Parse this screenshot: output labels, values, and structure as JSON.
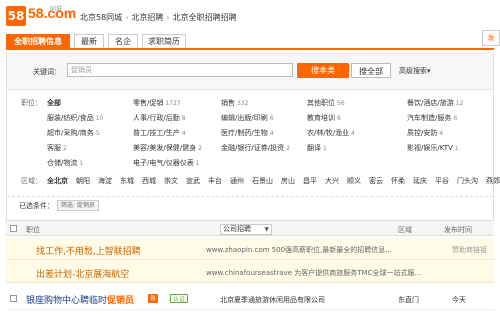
{
  "header": {
    "logo_text": "58.com",
    "logo_sub": "同城",
    "breadcrumb": [
      "北京58同城",
      "北京招聘",
      "北京全职招聘招聘"
    ]
  },
  "tabs": [
    "全职招聘信息",
    "最新",
    "名企",
    "求职简历"
  ],
  "tab_cut_label": "发",
  "search": {
    "label": "关键词：",
    "value": "促销员",
    "search_button": "搜本类",
    "search_all_button": "搜全部",
    "advanced": "高级搜索▾"
  },
  "job_categories": {
    "label": "职位：",
    "items": [
      {
        "text": "全部",
        "num": ""
      },
      {
        "text": "零售/促销",
        "num": "1727"
      },
      {
        "text": "销售",
        "num": "332"
      },
      {
        "text": "其他职位",
        "num": "56"
      },
      {
        "text": "餐饮/酒店/旅游",
        "num": "12"
      },
      {
        "text": "服装/纺织/食品",
        "num": "10"
      },
      {
        "text": "人事/行政/后勤",
        "num": "8"
      },
      {
        "text": "编辑/出版/印刷",
        "num": "6"
      },
      {
        "text": "教育培训",
        "num": "6"
      },
      {
        "text": "汽车制造/服务",
        "num": "6"
      },
      {
        "text": "超市/采购/商务",
        "num": "5"
      },
      {
        "text": "普工/技工/生产",
        "num": "4"
      },
      {
        "text": "医疗/制药/生物",
        "num": "4"
      },
      {
        "text": "农/林/牧/渔业",
        "num": "4"
      },
      {
        "text": "质控/安防",
        "num": "4"
      },
      {
        "text": "客服",
        "num": "2"
      },
      {
        "text": "美容/美发/保健/健身",
        "num": "2"
      },
      {
        "text": "金融/银行/证券/投资",
        "num": "2"
      },
      {
        "text": "翻译",
        "num": "1"
      },
      {
        "text": "影视/娱乐/KTV",
        "num": "1"
      },
      {
        "text": "仓储/物流",
        "num": "1"
      },
      {
        "text": "电子/电气/仪器仪表",
        "num": "1"
      }
    ]
  },
  "regions": {
    "label": "区域：",
    "items": [
      "全北京",
      "朝阳",
      "海淀",
      "东城",
      "西城",
      "崇文",
      "宣武",
      "丰台",
      "通州",
      "石景山",
      "房山",
      "昌平",
      "大兴",
      "顺义",
      "密云",
      "怀柔",
      "延庆",
      "平谷",
      "门头沟",
      "燕郊"
    ]
  },
  "selected": {
    "label": "已选条件：",
    "tag": "筛选: 促销员"
  },
  "list_header": {
    "title": "职位",
    "company": "公司招聘",
    "area": "区域",
    "time": "发布时间"
  },
  "ads": [
    {
      "title": "找工作,不用愁,上智联招聘",
      "desc": "www.zhaopin.com 500强高薪职位,最新最全的招聘信息...",
      "sponsor": "赞助商链接"
    },
    {
      "title": "出差计划-北京展海航空",
      "desc": "www.chinafourseastrave 为客户提供商旅服务TMC全球一站式服...",
      "sponsor": ""
    }
  ],
  "job": {
    "title_prefix": "银座购物中心聘临时",
    "title_highlight": "促销员",
    "badge": "急",
    "badge2": "认证",
    "company": "北京夏季通旅游休闲用品有限公司",
    "area": "东直门",
    "time": "今天"
  }
}
